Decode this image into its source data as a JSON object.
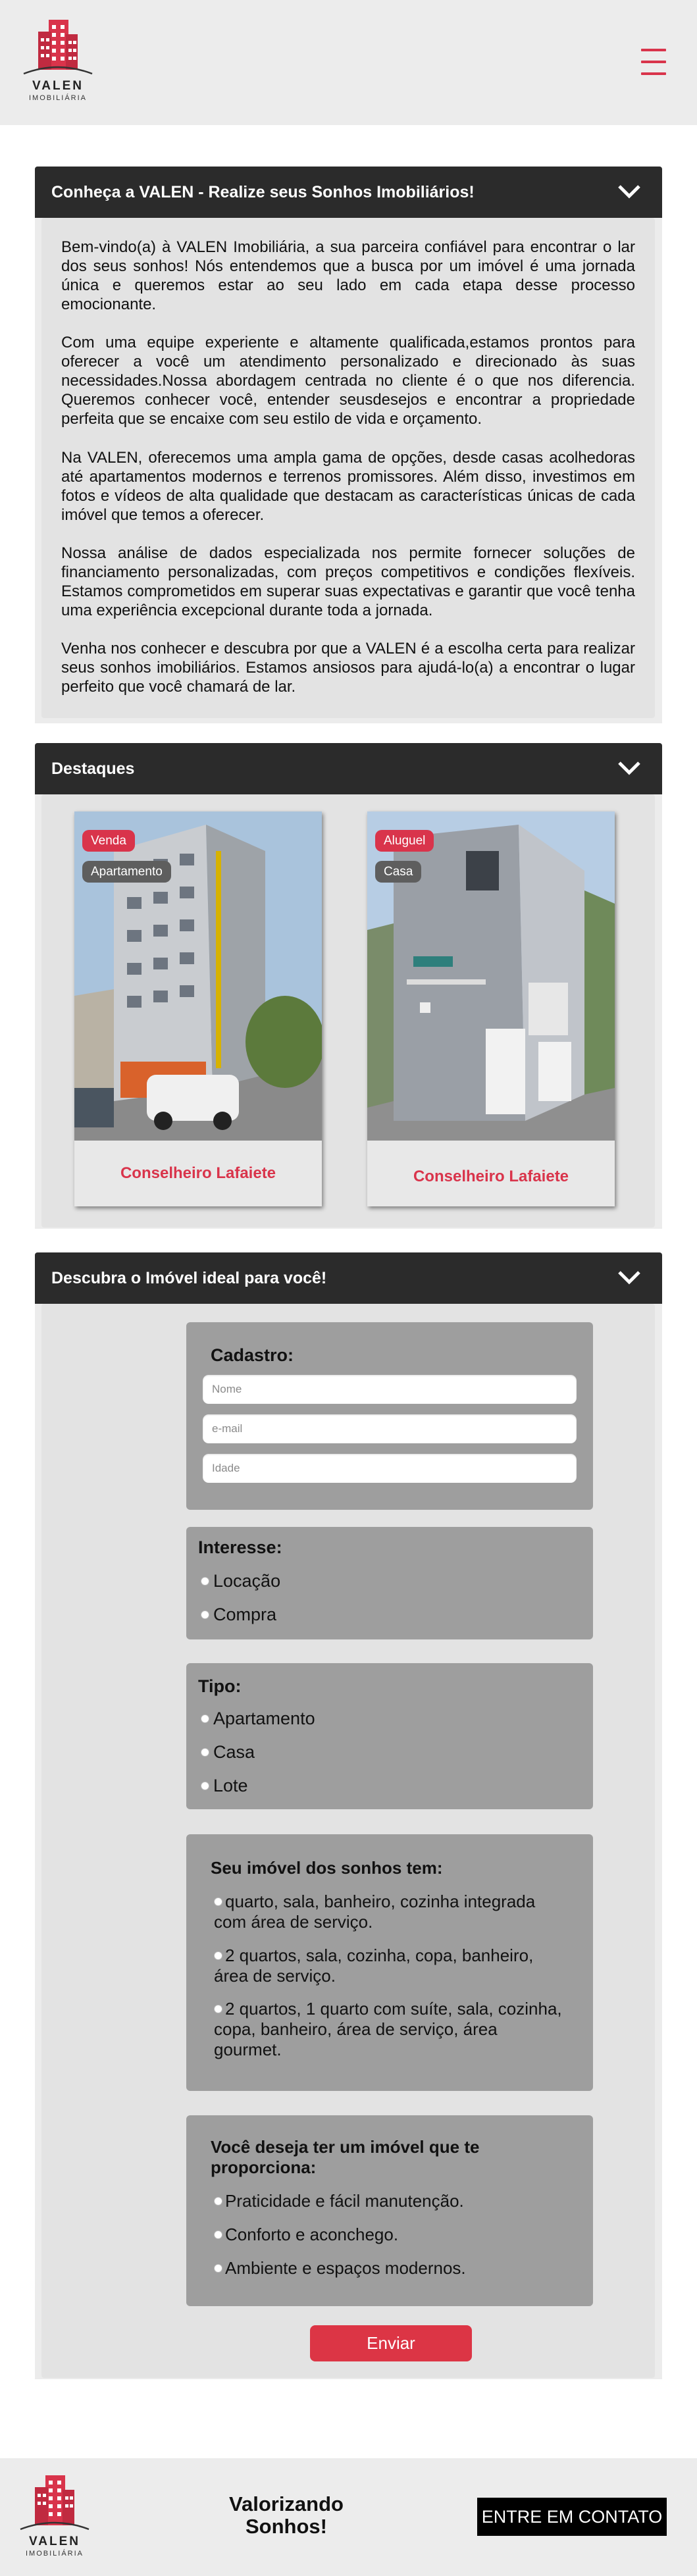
{
  "brand": {
    "name": "VALEN",
    "subtitle": "IMOBILIÁRIA",
    "accent_color": "#d9344b"
  },
  "header": {
    "menu_icon": "hamburger-menu-icon"
  },
  "intro": {
    "title": "Conheça a VALEN - Realize seus Sonhos Imobiliários!",
    "paragraphs": [
      "Bem-vindo(a) à VALEN Imobiliária, a sua parceira confiável para encontrar o lar dos seus sonhos! Nós entendemos que a busca por um imóvel é uma jornada única e queremos estar ao seu lado em cada etapa desse processo emocionante.",
      "Com uma equipe experiente e altamente qualificada,estamos prontos para oferecer a você um atendimento personalizado e direcionado às suas necessidades.Nossa abordagem centrada no cliente é o que nos diferencia. Queremos conhecer você, entender seusdesejos e encontrar a propriedade perfeita que se encaixe com seu estilo de vida e orçamento.",
      "Na VALEN, oferecemos uma ampla gama de opções, desde casas acolhedoras até apartamentos modernos e terrenos promissores. Além disso, investimos em fotos e vídeos de alta qualidade que destacam as características únicas de cada imóvel que temos a oferecer.",
      "Nossa análise de dados especializada nos permite fornecer soluções de financiamento personalizadas, com preços competitivos e condições flexíveis. Estamos comprometidos em superar suas expectativas e garantir que você tenha uma experiência excepcional durante toda a jornada.",
      "Venha nos conhecer e descubra por que a VALEN é a escolha certa para realizar seus sonhos imobiliários. Estamos ansiosos para ajudá-lo(a) a encontrar o lugar perfeito que você chamará de lar."
    ]
  },
  "highlights": {
    "title": "Destaques",
    "properties": [
      {
        "deal": "Venda",
        "type": "Apartamento",
        "location": "Conselheiro Lafaiete"
      },
      {
        "deal": "Aluguel",
        "type": "Casa",
        "location": "Conselheiro Lafaiete"
      }
    ]
  },
  "finder": {
    "title": "Descubra o Imóvel ideal para você!",
    "cadastro": {
      "heading": "Cadastro:",
      "name_placeholder": "Nome",
      "email_placeholder": "e-mail",
      "age_placeholder": "Idade"
    },
    "interesse": {
      "heading": "Interesse:",
      "options": [
        "Locação",
        "Compra"
      ]
    },
    "tipo": {
      "heading": "Tipo:",
      "options": [
        "Apartamento",
        "Casa",
        "Lote"
      ]
    },
    "sonhos": {
      "heading": "Seu imóvel dos sonhos tem:",
      "options": [
        "quarto, sala, banheiro, cozinha integrada com área de serviço.",
        "2 quartos, sala, cozinha, copa, banheiro, área de serviço.",
        "2 quartos, 1 quarto com suíte, sala, cozinha, copa, banheiro, área de serviço, área gourmet."
      ]
    },
    "proporciona": {
      "heading": "Você deseja ter um imóvel que te proporciona:",
      "options": [
        "Praticidade e fácil manutenção.",
        "Conforto e aconchego.",
        "Ambiente e espaços modernos."
      ]
    },
    "submit_label": "Enviar"
  },
  "footer": {
    "slogan": "Valorizando Sonhos!",
    "contact_label": "ENTRE EM CONTATO"
  }
}
